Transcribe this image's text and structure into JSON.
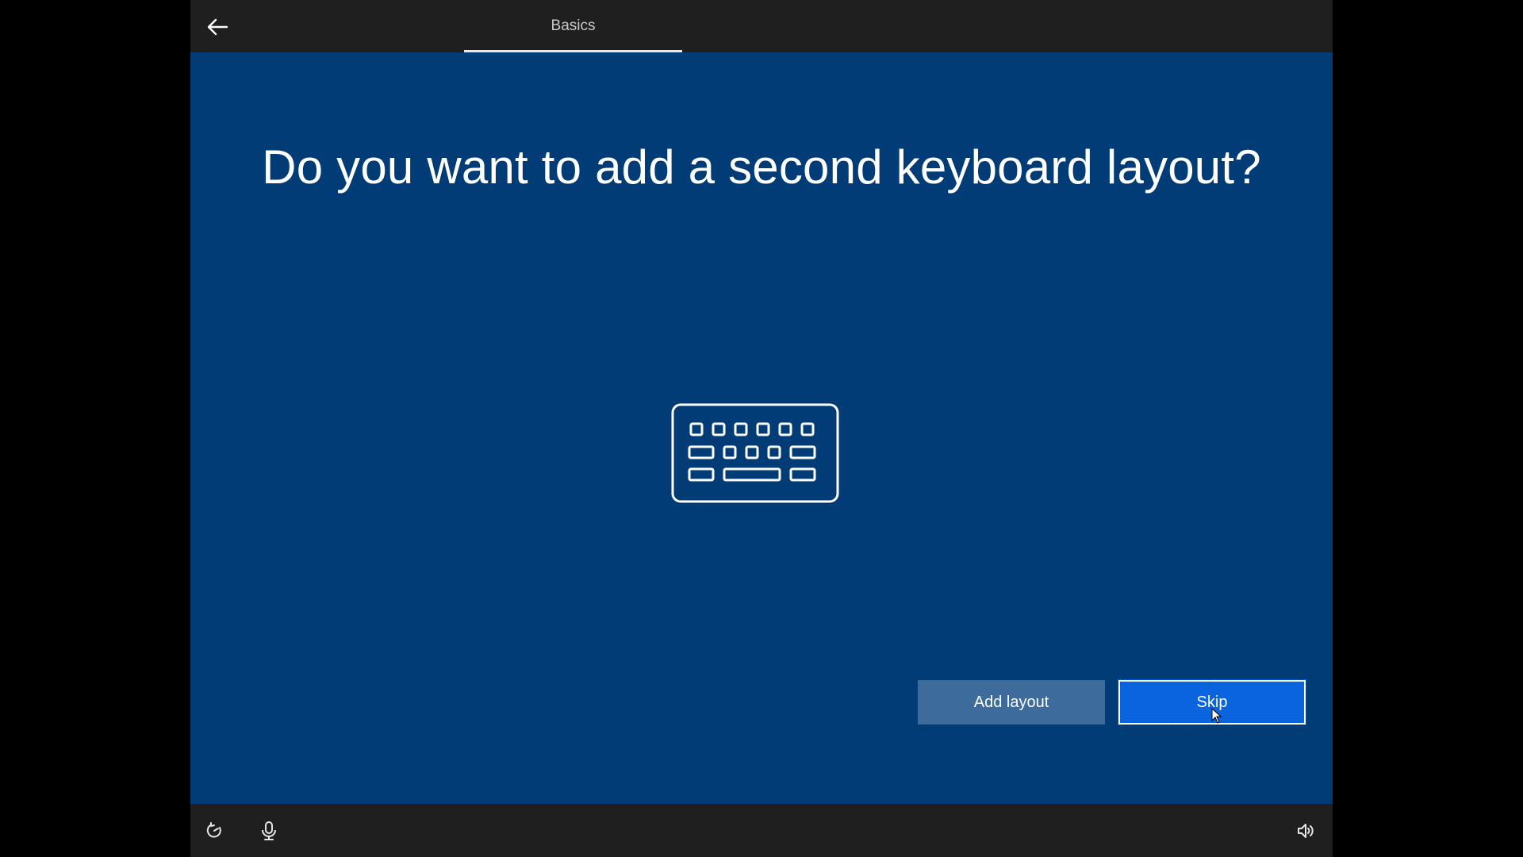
{
  "header": {
    "tab_label": "Basics"
  },
  "main": {
    "title": "Do you want to add a second keyboard layout?",
    "illustration_icon": "keyboard-icon"
  },
  "actions": {
    "add_layout_label": "Add layout",
    "skip_label": "Skip"
  },
  "footer": {
    "icons": [
      "ease-of-access-icon",
      "microphone-icon",
      "volume-icon"
    ]
  },
  "colors": {
    "main_background": "#023c77",
    "bar_background": "#1f1f1f",
    "primary_button": "#0a64dd",
    "secondary_button": "#3c6b9c"
  }
}
